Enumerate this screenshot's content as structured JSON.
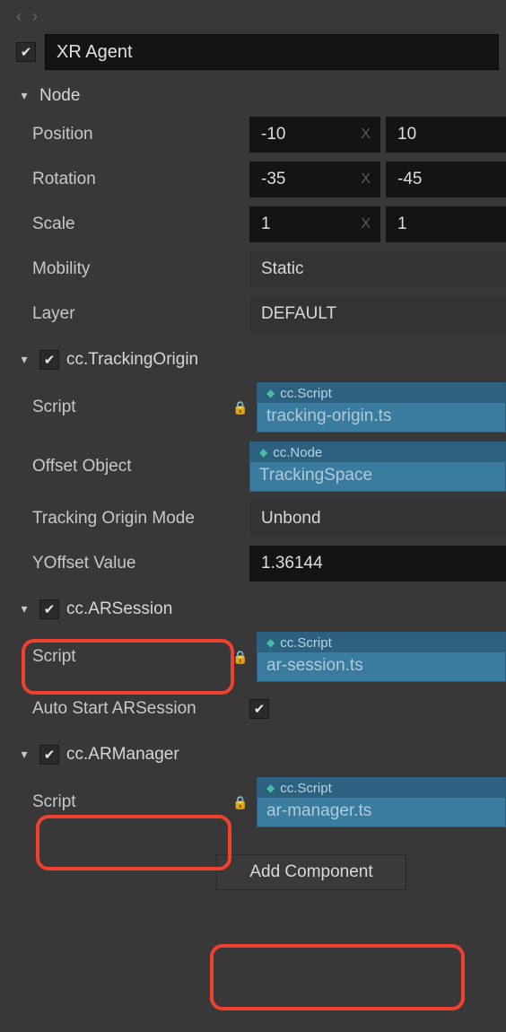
{
  "nav": {
    "back_glyph": "‹",
    "fwd_glyph": "›"
  },
  "entity": {
    "enabled": true,
    "name": "XR Agent"
  },
  "node_section": {
    "title": "Node"
  },
  "node": {
    "position": {
      "label": "Position",
      "x": "-10",
      "y": "10",
      "axis_x": "X"
    },
    "rotation": {
      "label": "Rotation",
      "x": "-35",
      "y": "-45",
      "axis_x": "X"
    },
    "scale": {
      "label": "Scale",
      "x": "1",
      "y": "1",
      "axis_x": "X"
    },
    "mobility": {
      "label": "Mobility",
      "value": "Static"
    },
    "layer": {
      "label": "Layer",
      "value": "DEFAULT"
    }
  },
  "tracking_origin": {
    "title": "cc.TrackingOrigin",
    "enabled": true,
    "script": {
      "label": "Script",
      "tag": "cc.Script",
      "value": "tracking-origin.ts"
    },
    "offset_object": {
      "label": "Offset Object",
      "tag": "cc.Node",
      "value": "TrackingSpace"
    },
    "mode": {
      "label": "Tracking Origin Mode",
      "value": "Unbond"
    },
    "yoffset": {
      "label": "YOffset Value",
      "value": "1.36144"
    }
  },
  "ar_session": {
    "title": "cc.ARSession",
    "enabled": true,
    "script": {
      "label": "Script",
      "tag": "cc.Script",
      "value": "ar-session.ts"
    },
    "autostart": {
      "label": "Auto Start ARSession",
      "value": true
    }
  },
  "ar_manager": {
    "title": "cc.ARManager",
    "enabled": true,
    "script": {
      "label": "Script",
      "tag": "cc.Script",
      "value": "ar-manager.ts"
    }
  },
  "add_component": {
    "label": "Add Component"
  }
}
